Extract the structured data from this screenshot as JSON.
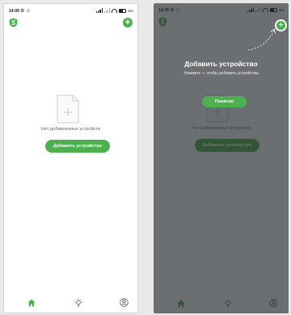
{
  "status": {
    "time": "14:09",
    "mini_icons": "⚙ ☺",
    "battery": "5%"
  },
  "header": {
    "add_label": "+"
  },
  "empty_state": {
    "file_plus": "+",
    "text": "Нет добавленных устройств",
    "add_button": "Добавить устройство"
  },
  "onboarding": {
    "title": "Добавить устройство",
    "subtitle": "Нажмите +, чтобы добавить устройства",
    "ok_button": "Понятно"
  },
  "colors": {
    "accent": "#4caf50",
    "overlay": "#262b2d"
  },
  "icons": [
    "shield-logo-icon",
    "plus-circle-icon",
    "file-plus-icon",
    "home-icon",
    "lightbulb-icon",
    "profile-icon"
  ]
}
